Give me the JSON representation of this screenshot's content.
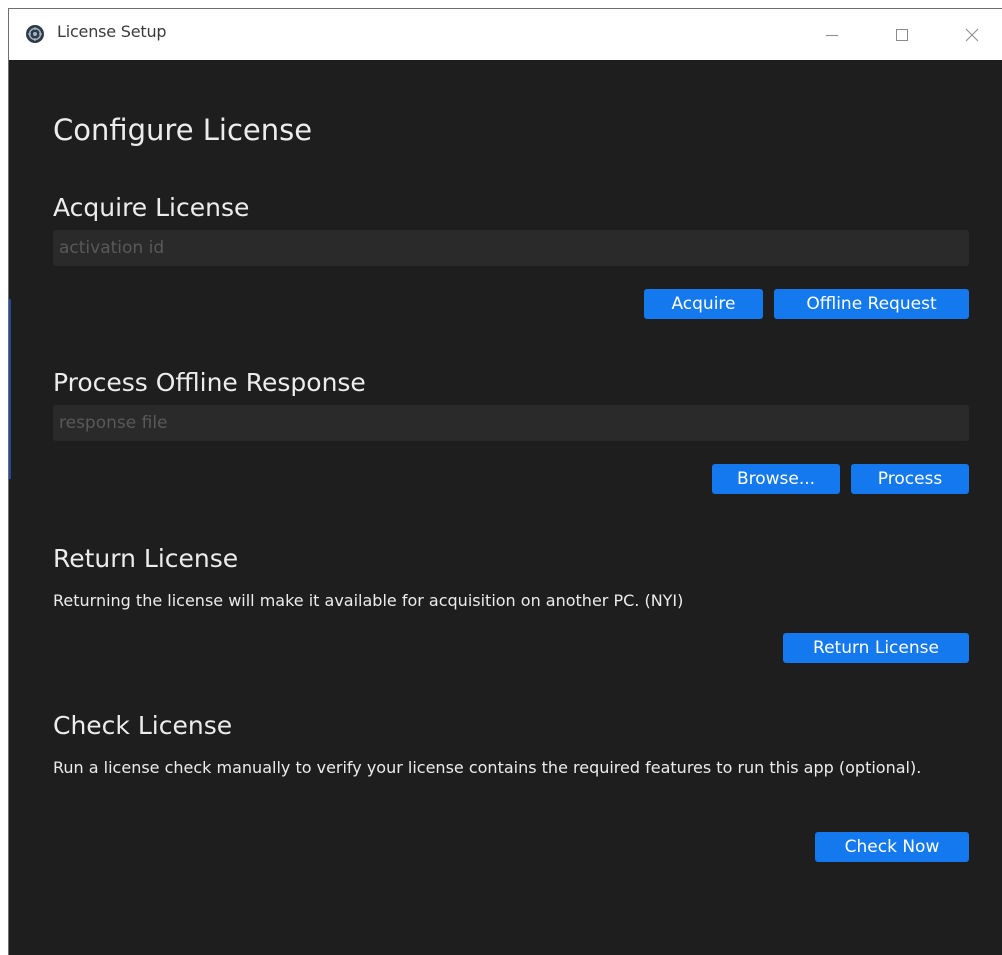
{
  "window": {
    "title": "License Setup",
    "app_icon": "app-logo-icon",
    "controls": {
      "minimize_icon": "minimize-icon",
      "maximize_icon": "maximize-icon",
      "close_icon": "close-icon"
    }
  },
  "page": {
    "title": "Configure License"
  },
  "acquire": {
    "title": "Acquire License",
    "input_value": "",
    "input_placeholder": "activation id",
    "acquire_label": "Acquire",
    "offline_request_label": "Offline Request"
  },
  "offline_response": {
    "title": "Process Offline Response",
    "input_value": "",
    "input_placeholder": "response file",
    "browse_label": "Browse...",
    "process_label": "Process"
  },
  "return_license": {
    "title": "Return License",
    "description": "Returning the license will make it available for acquisition on another PC. (NYI)",
    "button_label": "Return License"
  },
  "check_license": {
    "title": "Check License",
    "description": "Run a license check manually to verify your license contains the required features to run this app (optional).",
    "button_label": "Check Now"
  },
  "colors": {
    "background": "#1e1e1f",
    "titlebar": "#ffffff",
    "accent_button": "#1479ef",
    "input_background": "#2a2a2b",
    "text": "#ececec",
    "placeholder": "#595959"
  }
}
